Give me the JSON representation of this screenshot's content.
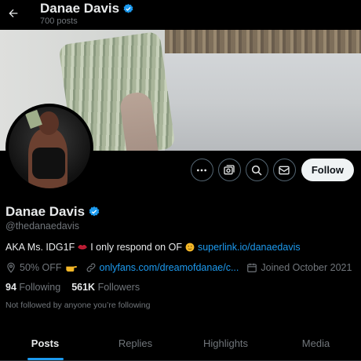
{
  "header": {
    "name": "Danae Davis",
    "posts": "700 posts"
  },
  "actions": {
    "follow_label": "Follow"
  },
  "profile": {
    "name": "Danae Davis",
    "handle": "@thedanaedavis",
    "bio_text": "AKA Ms. IDG1F",
    "bio_text2": "I only respond on OF",
    "bio_link": "superlink.io/danaedavis",
    "location": "50% OFF",
    "website": "onlyfans.com/dreamofdanae/c...",
    "joined": "Joined October 2021",
    "following_count": "94",
    "following_label": "Following",
    "followers_count": "561K",
    "followers_label": "Followers",
    "not_followed": "Not followed by anyone you’re following"
  },
  "tabs": [
    {
      "label": "Posts",
      "active": true
    },
    {
      "label": "Replies",
      "active": false
    },
    {
      "label": "Highlights",
      "active": false
    },
    {
      "label": "Media",
      "active": false
    }
  ],
  "colors": {
    "accent": "#1d9bf0",
    "background": "#000000",
    "text": "#e7e9ea",
    "muted": "#71767b"
  },
  "icons": {
    "back": "arrow-left-icon",
    "verified": "verified-badge-icon",
    "more": "more-icon",
    "subscribe": "subscribe-icon",
    "search": "search-icon",
    "message": "mail-icon",
    "location": "location-icon",
    "link": "link-icon",
    "calendar": "calendar-icon"
  }
}
